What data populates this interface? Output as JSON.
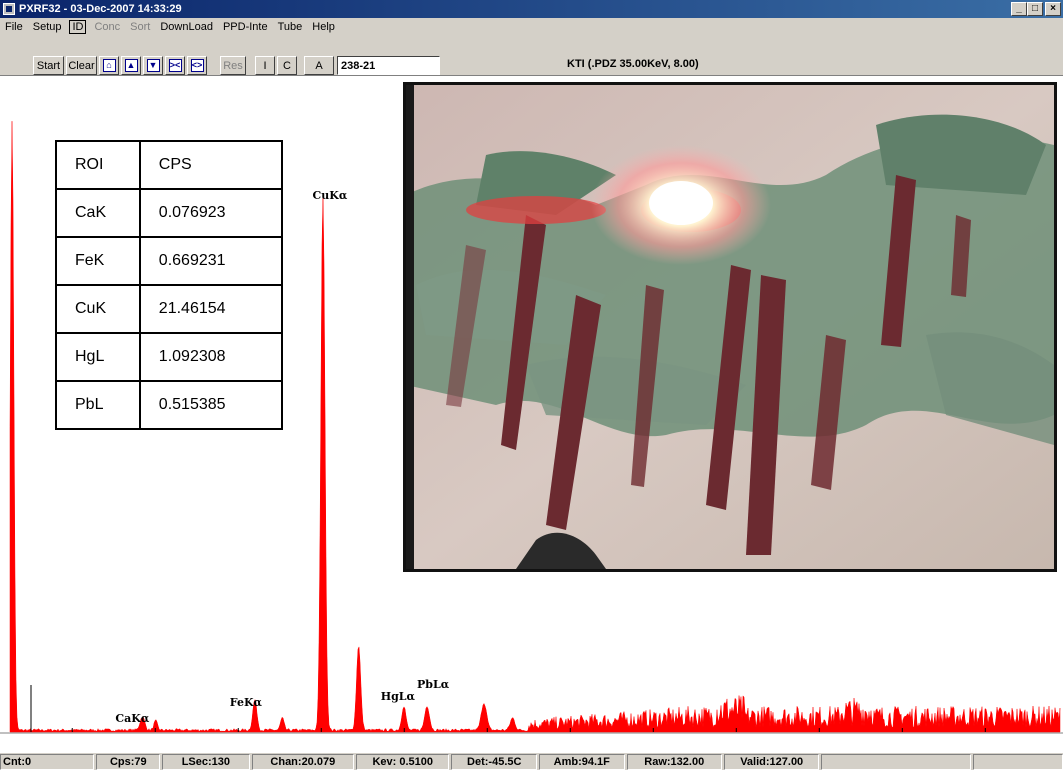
{
  "window": {
    "title": "PXRF32 - 03-Dec-2007 14:33:29",
    "minimize": "_",
    "maximize": "□",
    "close": "×"
  },
  "menu": [
    {
      "label": "File",
      "disabled": false
    },
    {
      "label": "Setup",
      "disabled": false
    },
    {
      "label": "ID",
      "disabled": false,
      "boxed": true
    },
    {
      "label": "Conc",
      "disabled": true
    },
    {
      "label": "Sort",
      "disabled": true
    },
    {
      "label": "DownLoad",
      "disabled": false
    },
    {
      "label": "PPD-Inte",
      "disabled": false
    },
    {
      "label": "Tube",
      "disabled": false
    },
    {
      "label": "Help",
      "disabled": false
    }
  ],
  "toolbar": {
    "start": "Start",
    "clear": "Clear",
    "res": "Res",
    "i": "I",
    "c": "C",
    "a": "A",
    "sample_id": "238-21",
    "status": "KTI  (.PDZ 35.00KeV, 8.00)"
  },
  "roi_table": {
    "headers": [
      "ROI",
      "CPS"
    ],
    "rows": [
      [
        "CaK",
        "0.076923"
      ],
      [
        "FeK",
        "0.669231"
      ],
      [
        "CuK",
        "21.46154"
      ],
      [
        "HgL",
        "1.092308"
      ],
      [
        "PbL",
        "0.515385"
      ]
    ]
  },
  "chart_data": {
    "type": "area",
    "color": "#ff0000",
    "xlim": [
      0.5,
      25.8
    ],
    "xticks": [
      "2.00",
      "4.00",
      "6.00",
      "8.00",
      "10.00",
      "12.00",
      "14.00",
      "16.00",
      "18.00",
      "20.00",
      "22.00",
      "24.00"
    ],
    "xtick_values": [
      2,
      4,
      6,
      8,
      10,
      12,
      14,
      16,
      18,
      20,
      22,
      24
    ],
    "peaks": [
      {
        "label": "CaKα",
        "x": 3.69
      },
      {
        "label": "FeKα",
        "x": 6.4
      },
      {
        "label": "CuKα",
        "x": 8.04
      },
      {
        "label": "HgLα",
        "x": 9.99
      },
      {
        "label": "PbLα",
        "x": 10.55
      }
    ],
    "cursor_x": 1.0
  },
  "statusbar": [
    "Cnt:0",
    "Cps:79",
    "LSec:130",
    "Chan:20.079",
    "Kev: 0.5100",
    "Det:-45.5C",
    "Amb:94.1F",
    "Raw:132.00",
    "Valid:127.00",
    "",
    ""
  ]
}
